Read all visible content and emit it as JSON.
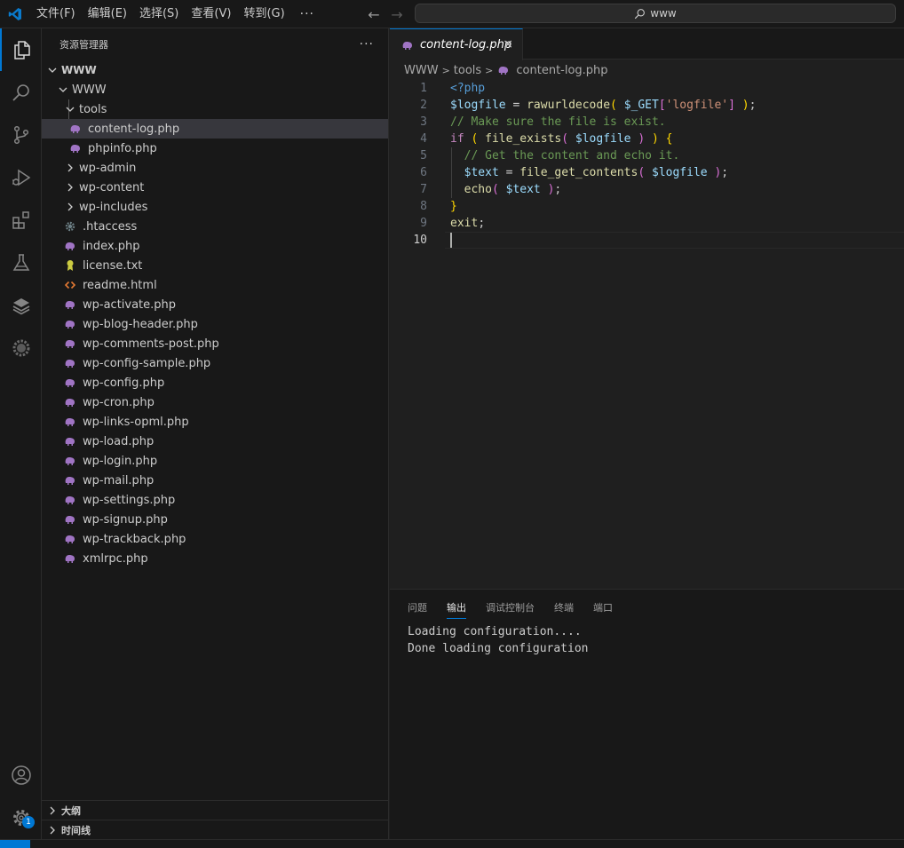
{
  "title_bar": {
    "menus": [
      "文件(F)",
      "编辑(E)",
      "选择(S)",
      "查看(V)",
      "转到(G)"
    ],
    "more": "···",
    "search_label": "www"
  },
  "activity_bar": {
    "icons": [
      "files-icon",
      "search-icon",
      "source-control-icon",
      "run-debug-icon",
      "extensions-icon",
      "testing-icon",
      "layers-icon",
      "gear-flower-icon"
    ],
    "account_icon": "account-icon",
    "manage_icon": "manage-gear-icon",
    "badge": "1"
  },
  "sidebar": {
    "title": "资源管理器",
    "more": "···",
    "root": "WWW",
    "folder": "WWW",
    "subfolder": "tools",
    "tools_files": [
      "content-log.php",
      "phpinfo.php"
    ],
    "folders": [
      "wp-admin",
      "wp-content",
      "wp-includes"
    ],
    "files": [
      {
        "name": ".htaccess",
        "icon": "gear-icon"
      },
      {
        "name": "index.php",
        "icon": "php-icon"
      },
      {
        "name": "license.txt",
        "icon": "license-icon"
      },
      {
        "name": "readme.html",
        "icon": "html-icon"
      },
      {
        "name": "wp-activate.php",
        "icon": "php-icon"
      },
      {
        "name": "wp-blog-header.php",
        "icon": "php-icon"
      },
      {
        "name": "wp-comments-post.php",
        "icon": "php-icon"
      },
      {
        "name": "wp-config-sample.php",
        "icon": "php-icon"
      },
      {
        "name": "wp-config.php",
        "icon": "php-icon"
      },
      {
        "name": "wp-cron.php",
        "icon": "php-icon"
      },
      {
        "name": "wp-links-opml.php",
        "icon": "php-icon"
      },
      {
        "name": "wp-load.php",
        "icon": "php-icon"
      },
      {
        "name": "wp-login.php",
        "icon": "php-icon"
      },
      {
        "name": "wp-mail.php",
        "icon": "php-icon"
      },
      {
        "name": "wp-settings.php",
        "icon": "php-icon"
      },
      {
        "name": "wp-signup.php",
        "icon": "php-icon"
      },
      {
        "name": "wp-trackback.php",
        "icon": "php-icon"
      },
      {
        "name": "xmlrpc.php",
        "icon": "php-icon"
      }
    ],
    "outline": "大纲",
    "timeline": "时间线"
  },
  "editor": {
    "tab": "content-log.php",
    "close": "×",
    "breadcrumb": [
      "WWW",
      "tools",
      "content-log.php"
    ],
    "line_numbers": [
      "1",
      "2",
      "3",
      "4",
      "5",
      "6",
      "7",
      "8",
      "9",
      "10"
    ],
    "current_line": "10",
    "code_lines": [
      [
        {
          "t": "<?php",
          "c": "kw"
        }
      ],
      [
        {
          "t": "$logfile",
          "c": "var"
        },
        {
          "t": " = ",
          "c": ""
        },
        {
          "t": "rawurldecode",
          "c": "fn"
        },
        {
          "t": "( ",
          "c": "b1"
        },
        {
          "t": "$_GET",
          "c": "var"
        },
        {
          "t": "[",
          "c": "b2"
        },
        {
          "t": "'logfile'",
          "c": "str"
        },
        {
          "t": "]",
          "c": "b2"
        },
        {
          "t": " )",
          "c": "b1"
        },
        {
          "t": ";",
          "c": ""
        }
      ],
      [
        {
          "t": "// Make sure the file is exist.",
          "c": "com"
        }
      ],
      [
        {
          "t": "if",
          "c": "ctl"
        },
        {
          "t": " ",
          "c": ""
        },
        {
          "t": "(",
          "c": "b1"
        },
        {
          "t": " ",
          "c": ""
        },
        {
          "t": "file_exists",
          "c": "fn"
        },
        {
          "t": "( ",
          "c": "b2"
        },
        {
          "t": "$logfile",
          "c": "var"
        },
        {
          "t": " )",
          "c": "b2"
        },
        {
          "t": " ",
          "c": ""
        },
        {
          "t": ")",
          "c": "b1"
        },
        {
          "t": " ",
          "c": ""
        },
        {
          "t": "{",
          "c": "b1"
        }
      ],
      [
        {
          "t": "  // Get the content and echo it.",
          "c": "com"
        }
      ],
      [
        {
          "t": "  ",
          "c": ""
        },
        {
          "t": "$text",
          "c": "var"
        },
        {
          "t": " = ",
          "c": ""
        },
        {
          "t": "file_get_contents",
          "c": "fn"
        },
        {
          "t": "( ",
          "c": "b2"
        },
        {
          "t": "$logfile",
          "c": "var"
        },
        {
          "t": " )",
          "c": "b2"
        },
        {
          "t": ";",
          "c": ""
        }
      ],
      [
        {
          "t": "  ",
          "c": ""
        },
        {
          "t": "echo",
          "c": "fn"
        },
        {
          "t": "( ",
          "c": "b2"
        },
        {
          "t": "$text",
          "c": "var"
        },
        {
          "t": " )",
          "c": "b2"
        },
        {
          "t": ";",
          "c": ""
        }
      ],
      [
        {
          "t": "}",
          "c": "b1"
        }
      ],
      [
        {
          "t": "exit",
          "c": "fn"
        },
        {
          "t": ";",
          "c": ""
        }
      ],
      []
    ]
  },
  "panel": {
    "tabs": [
      "问题",
      "输出",
      "调试控制台",
      "终端",
      "端口"
    ],
    "active_tab": "输出",
    "output": [
      "Loading configuration....",
      "Done loading configuration"
    ]
  }
}
